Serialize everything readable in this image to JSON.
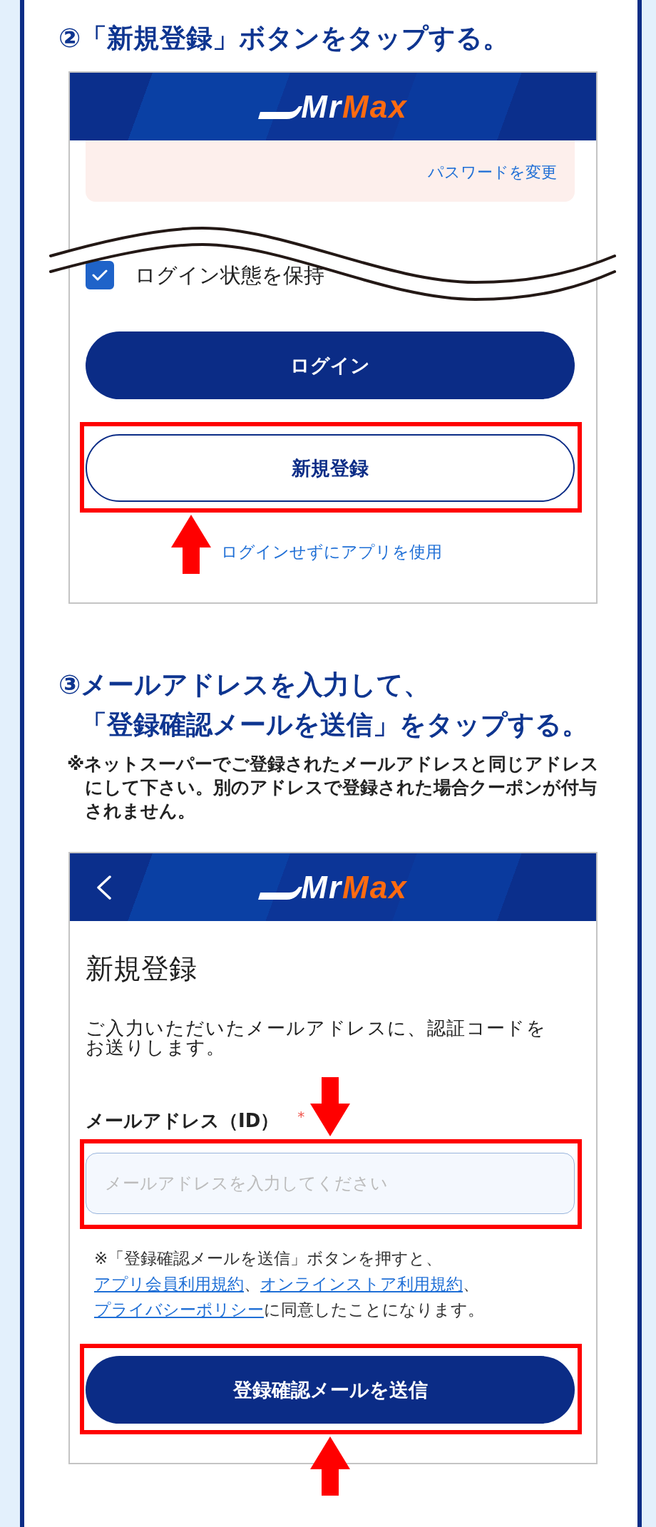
{
  "step_2": {
    "number": "②",
    "title_lines": [
      "「新規登録」ボタンをタップする。"
    ],
    "screen": {
      "header": {
        "logo": {
          "primary": "Mr",
          "accent": "Max"
        }
      },
      "notice": {
        "link": "パスワードを変更"
      },
      "remember_me": {
        "label": "ログイン状態を保持",
        "checked": true
      },
      "login_button": "ログイン",
      "register_button": {
        "label": "新規登録",
        "highlighted": true,
        "arrow_below": true
      },
      "skip_link": "ログインせずにアプリを使用"
    }
  },
  "step_3": {
    "number": "③",
    "title_lines": [
      "メールアドレスを入力して、",
      "「登録確認メールを送信」をタップする。"
    ],
    "note": "※ネットスーパーでご登録されたメールアドレスと同じアドレスにして下さい。別のアドレスで登録された場合クーポンが付与されません。",
    "screen": {
      "header": {
        "back_button": true,
        "logo": {
          "primary": "Mr",
          "accent": "Max"
        }
      },
      "heading": "新規登録",
      "description": "ご入力いただいたメールアドレスに、認証コードをお送りします。",
      "email_field": {
        "label": "メールアドレス（ID）",
        "required_mark": "*",
        "placeholder": "メールアドレスを入力してください",
        "highlighted": true,
        "arrow_above": true
      },
      "terms": [
        {
          "kind": "text",
          "text": "※「登録確認メールを送信」ボタンを押すと、"
        },
        {
          "kind": "link",
          "text": "アプリ会員利用規約"
        },
        {
          "kind": "text",
          "text": "、"
        },
        {
          "kind": "link",
          "text": "オンラインストア利用規約"
        },
        {
          "kind": "text",
          "text": "、"
        },
        {
          "kind": "link",
          "text": "プライバシーポリシー"
        },
        {
          "kind": "text",
          "text": "に同意したことになります。"
        }
      ],
      "submit_button": {
        "label": "登録確認メールを送信",
        "highlighted": true,
        "arrow_below": true
      }
    }
  }
}
